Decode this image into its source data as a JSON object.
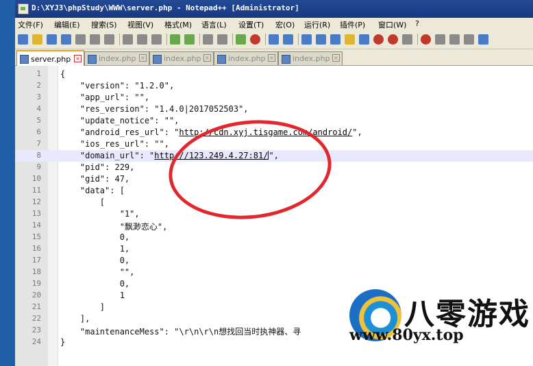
{
  "window": {
    "title": "D:\\XYJ3\\phpStudy\\WWW\\server.php - Notepad++ [Administrator]"
  },
  "menu": [
    "文件(F)",
    "编辑(E)",
    "搜索(S)",
    "视图(V)",
    "格式(M)",
    "语言(L)",
    "设置(T)",
    "宏(O)",
    "运行(R)",
    "插件(P)",
    "窗口(W)",
    "?"
  ],
  "tabs": [
    {
      "label": "server.php",
      "active": true
    },
    {
      "label": "index.php",
      "active": false
    },
    {
      "label": "index.php",
      "active": false
    },
    {
      "label": "index.php",
      "active": false
    },
    {
      "label": "index.php",
      "active": false
    }
  ],
  "editor": {
    "current_line": 8,
    "lines": [
      {
        "n": "1",
        "t": "{"
      },
      {
        "n": "2",
        "t": "    \"version\": \"1.2.0\","
      },
      {
        "n": "3",
        "t": "    \"app_url\": \"\","
      },
      {
        "n": "4",
        "t": "    \"res_version\": \"1.4.0|2017052503\","
      },
      {
        "n": "5",
        "t": "    \"update_notice\": \"\","
      },
      {
        "n": "6",
        "a": "    \"android_res_url\": \"",
        "l": "http://cdn.xyj.tisgame.com/android/",
        "b": "\","
      },
      {
        "n": "7",
        "t": "    \"ios_res_url\": \"\","
      },
      {
        "n": "8",
        "a": "    \"domain_url\": \"",
        "l": "http://123.249.4.27:81/",
        "b": "\",",
        "caret": true
      },
      {
        "n": "9",
        "t": "    \"pid\": 229,"
      },
      {
        "n": "10",
        "t": "    \"gid\": 47,"
      },
      {
        "n": "11",
        "t": "    \"data\": ["
      },
      {
        "n": "12",
        "t": "        ["
      },
      {
        "n": "13",
        "t": "            \"1\","
      },
      {
        "n": "14",
        "t": "            \"飘渺恋心\","
      },
      {
        "n": "15",
        "t": "            0,"
      },
      {
        "n": "16",
        "t": "            1,"
      },
      {
        "n": "17",
        "t": "            0,"
      },
      {
        "n": "18",
        "t": "            \"\","
      },
      {
        "n": "19",
        "t": "            0,"
      },
      {
        "n": "20",
        "t": "            1"
      },
      {
        "n": "21",
        "t": "        ]"
      },
      {
        "n": "22",
        "t": "    ],"
      },
      {
        "n": "23",
        "t": "    \"maintenanceMess\": \"\\r\\n\\r\\n想找回当时执神器、寻"
      },
      {
        "n": "24",
        "t": "}"
      }
    ]
  },
  "watermark": {
    "title": "八零游戏",
    "url": "www.80yx.top"
  },
  "colors": {
    "annotation": "#e0282e",
    "titlebar": "#244a95",
    "current_line": "#e8e8ff"
  }
}
